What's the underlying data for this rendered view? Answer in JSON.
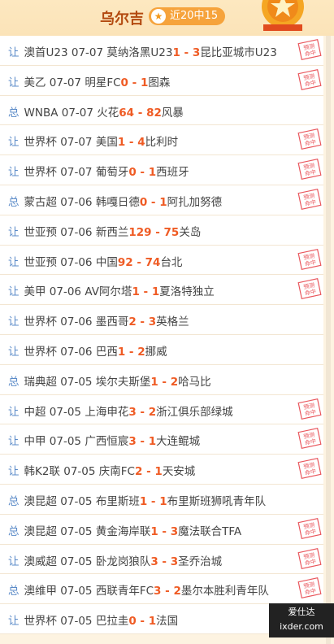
{
  "header": {
    "name": "乌尔吉",
    "record": "近20中15",
    "corner_icon": "medal-star-icon"
  },
  "colors": {
    "accent": "#ef5b24",
    "tag": "#5b8bc8",
    "stamp": "#e9565c",
    "badge": "#f6a33c"
  },
  "stamp_text": "预测命中",
  "rows": [
    {
      "tag": "让",
      "league": "澳首U23",
      "date": "07-07",
      "home": "莫纳洛黑U23",
      "s1": "1",
      "s2": "3",
      "away": "昆比亚城市U23",
      "hit": true
    },
    {
      "tag": "让",
      "league": "美乙",
      "date": "07-07",
      "home": "明星FC",
      "s1": "0",
      "s2": "1",
      "away": "图森",
      "hit": true
    },
    {
      "tag": "总",
      "league": "WNBA",
      "date": "07-07",
      "home": "火花",
      "s1": "64",
      "s2": "82",
      "away": "风暴",
      "hit": false
    },
    {
      "tag": "让",
      "league": "世界杯",
      "date": "07-07",
      "home": "美国",
      "s1": "1",
      "s2": "4",
      "away": "比利时",
      "hit": true
    },
    {
      "tag": "让",
      "league": "世界杯",
      "date": "07-07",
      "home": "葡萄牙",
      "s1": "0",
      "s2": "1",
      "away": "西班牙",
      "hit": true
    },
    {
      "tag": "总",
      "league": "蒙古超",
      "date": "07-06",
      "home": "韩嘎日德",
      "s1": "0",
      "s2": "1",
      "away": "阿扎加努德",
      "hit": true
    },
    {
      "tag": "让",
      "league": "世亚预",
      "date": "07-06",
      "home": "新西兰",
      "s1": "129",
      "s2": "75",
      "away": "关岛",
      "hit": false
    },
    {
      "tag": "让",
      "league": "世亚预",
      "date": "07-06",
      "home": "中国",
      "s1": "92",
      "s2": "74",
      "away": "台北",
      "hit": true
    },
    {
      "tag": "让",
      "league": "美甲",
      "date": "07-06",
      "home": "AV阿尔塔",
      "s1": "1",
      "s2": "1",
      "away": "夏洛特独立",
      "hit": true
    },
    {
      "tag": "让",
      "league": "世界杯",
      "date": "07-06",
      "home": "墨西哥",
      "s1": "2",
      "s2": "3",
      "away": "英格兰",
      "hit": false
    },
    {
      "tag": "让",
      "league": "世界杯",
      "date": "07-06",
      "home": "巴西",
      "s1": "1",
      "s2": "2",
      "away": "挪威",
      "hit": false
    },
    {
      "tag": "总",
      "league": "瑞典超",
      "date": "07-05",
      "home": "埃尔夫斯堡",
      "s1": "1",
      "s2": "2",
      "away": "哈马比",
      "hit": false
    },
    {
      "tag": "让",
      "league": "中超",
      "date": "07-05",
      "home": "上海申花",
      "s1": "3",
      "s2": "2",
      "away": "浙江俱乐部绿城",
      "hit": true
    },
    {
      "tag": "让",
      "league": "中甲",
      "date": "07-05",
      "home": "广西恒宸",
      "s1": "3",
      "s2": "1",
      "away": "大连鲲城",
      "hit": true
    },
    {
      "tag": "让",
      "league": "韩K2联",
      "date": "07-05",
      "home": "庆南FC",
      "s1": "2",
      "s2": "1",
      "away": "天安城",
      "hit": true
    },
    {
      "tag": "总",
      "league": "澳昆超",
      "date": "07-05",
      "home": "布里斯班",
      "s1": "1",
      "s2": "1",
      "away": "布里斯班狮吼青年队",
      "hit": false
    },
    {
      "tag": "总",
      "league": "澳昆超",
      "date": "07-05",
      "home": "黄金海岸联",
      "s1": "1",
      "s2": "3",
      "away": "魔法联合TFA",
      "hit": true
    },
    {
      "tag": "让",
      "league": "澳威超",
      "date": "07-05",
      "home": "卧龙岗狼队",
      "s1": "3",
      "s2": "3",
      "away": "圣乔治城",
      "hit": true
    },
    {
      "tag": "总",
      "league": "澳维甲",
      "date": "07-05",
      "home": "西联青年FC",
      "s1": "3",
      "s2": "2",
      "away": "墨尔本胜利青年队",
      "hit": true
    },
    {
      "tag": "让",
      "league": "世界杯",
      "date": "07-05",
      "home": "巴拉圭",
      "s1": "0",
      "s2": "1",
      "away": "法国",
      "hit": false
    }
  ],
  "watermark": {
    "line1": "爱仕达",
    "line2": "ixder.com"
  }
}
